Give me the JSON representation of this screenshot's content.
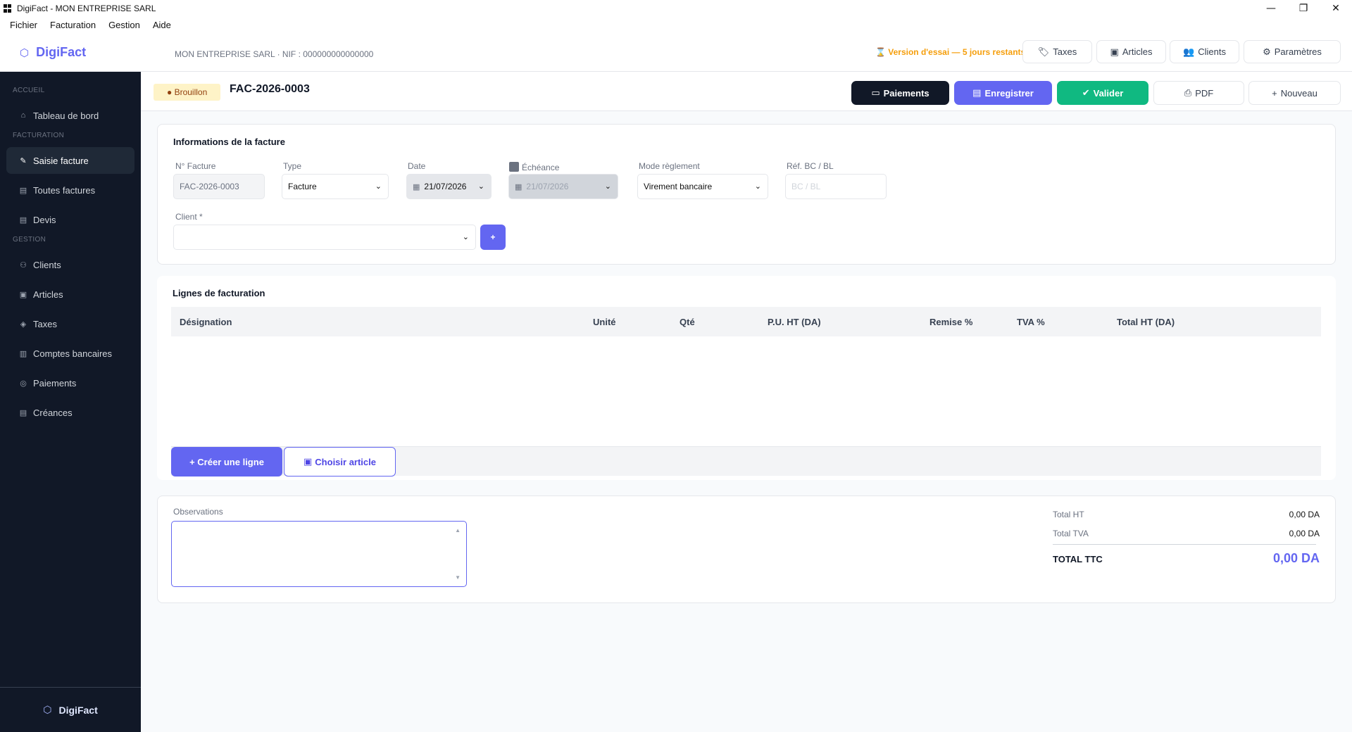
{
  "window": {
    "title": "DigiFact - MON ENTREPRISE SARL",
    "minimize": "—",
    "restore": "❐",
    "close": "✕"
  },
  "menu": [
    "Fichier",
    "Facturation",
    "Gestion",
    "Aide"
  ],
  "header": {
    "brand": "DigiFact",
    "company": "MON ENTREPRISE SARL  ·  NIF : 000000000000000",
    "trial": "⌛ Version d'essai — 5 jours restants",
    "buttons": [
      {
        "label": "Taxes",
        "icon": "tag-icon"
      },
      {
        "label": "Articles",
        "icon": "box-icon"
      },
      {
        "label": "Clients",
        "icon": "users-icon"
      },
      {
        "label": "Paramètres",
        "icon": "gear-icon"
      }
    ]
  },
  "sidebar": {
    "sections": {
      "accueil": "ACCUEIL",
      "facturation": "FACTURATION",
      "gestion": "GESTION"
    },
    "items": [
      {
        "label": "Tableau de bord",
        "icon": "home-icon"
      },
      {
        "label": "Saisie facture",
        "icon": "pencil-icon",
        "active": true
      },
      {
        "label": "Toutes factures",
        "icon": "document-icon"
      },
      {
        "label": "Devis",
        "icon": "document-icon"
      },
      {
        "label": "Clients",
        "icon": "users-icon"
      },
      {
        "label": "Articles",
        "icon": "box-icon"
      },
      {
        "label": "Taxes",
        "icon": "tag-icon"
      },
      {
        "label": "Comptes bancaires",
        "icon": "bank-icon"
      },
      {
        "label": "Paiements",
        "icon": "coin-icon"
      },
      {
        "label": "Créances",
        "icon": "document-icon"
      }
    ],
    "footer": "DigiFact"
  },
  "toolbar": {
    "status": "● Brouillon",
    "doc_number": "FAC-2026-0003",
    "payments": "Paiements",
    "save": "Enregistrer",
    "validate": "Valider",
    "pdf": "PDF",
    "new": "Nouveau"
  },
  "info": {
    "title": "Informations de la facture",
    "num_label": "N° Facture",
    "num_value": "FAC-2026-0003",
    "type_label": "Type",
    "type_value": "Facture",
    "date_label": "Date",
    "date_value": "21/07/2026",
    "due_label": "Échéance",
    "due_value": "21/07/2026",
    "payment_label": "Mode règlement",
    "payment_value": "Virement bancaire",
    "ref_label": "Réf. BC / BL",
    "ref_placeholder": "BC / BL",
    "client_label": "Client *",
    "client_value": "",
    "add_client": "+"
  },
  "lines": {
    "title": "Lignes de facturation",
    "columns": [
      "Désignation",
      "Unité",
      "Qté",
      "P.U. HT (DA)",
      "Remise %",
      "TVA %",
      "Total HT (DA)"
    ],
    "create_line": "+ Créer une ligne",
    "choose_article": "Choisir article"
  },
  "totals": {
    "observations_label": "Observations",
    "ht_label": "Total HT",
    "ht_value": "0,00 DA",
    "tva_label": "Total TVA",
    "tva_value": "0,00 DA",
    "ttc_label": "TOTAL TTC",
    "ttc_value": "0,00 DA"
  },
  "colors": {
    "accent": "#6366f1",
    "sidebar": "#111827",
    "success": "#10b981",
    "warning": "#f59e0b"
  }
}
